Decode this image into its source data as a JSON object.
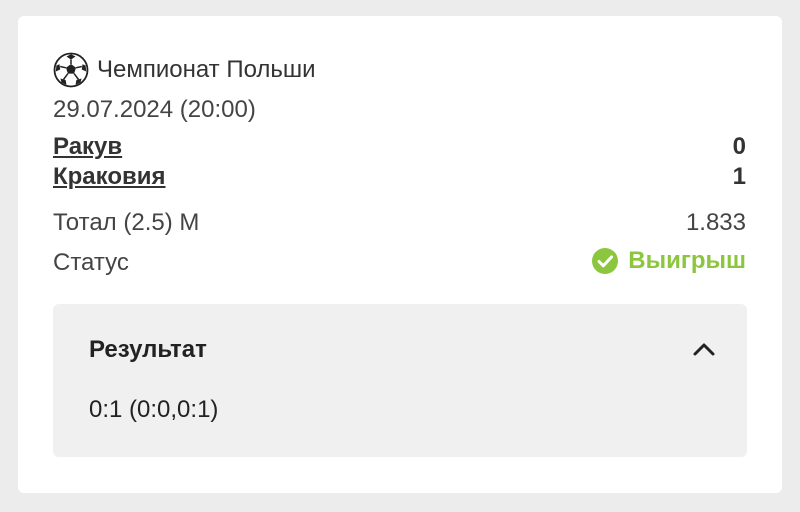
{
  "league": {
    "icon": "soccer-ball-icon",
    "name": "Чемпионат Польши"
  },
  "match": {
    "datetime": "29.07.2024 (20:00)",
    "home": {
      "name": "Ракув",
      "score": "0"
    },
    "away": {
      "name": "Краковия",
      "score": "1"
    }
  },
  "bet": {
    "market_label": "Тотал (2.5) М",
    "odds": "1.833",
    "status_label": "Статус",
    "status_value": "Выигрыш",
    "status_icon": "check-circle-icon",
    "status_color": "#8cc63f"
  },
  "result": {
    "title": "Результат",
    "toggle_icon": "chevron-up-icon",
    "value": "0:1 (0:0,0:1)"
  }
}
